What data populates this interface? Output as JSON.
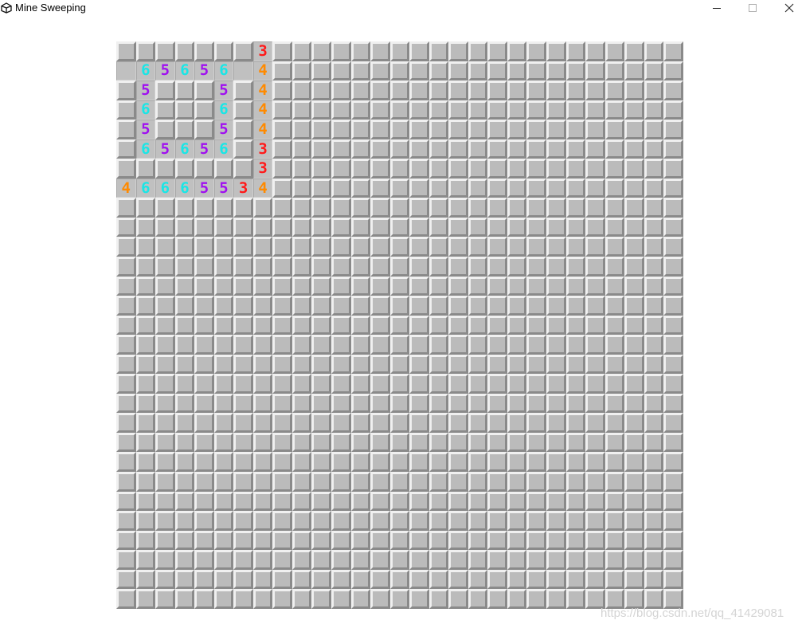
{
  "window": {
    "title": "Mine Sweeping",
    "icon": "unity-icon",
    "controls": [
      "minimize-icon",
      "maximize-icon",
      "close-icon"
    ]
  },
  "board": {
    "rows": 29,
    "cols": 29,
    "revealed": [
      {
        "r": 0,
        "c": 7,
        "v": "3"
      },
      {
        "r": 1,
        "c": 0,
        "v": ""
      },
      {
        "r": 1,
        "c": 1,
        "v": "6"
      },
      {
        "r": 1,
        "c": 2,
        "v": "5"
      },
      {
        "r": 1,
        "c": 3,
        "v": "6"
      },
      {
        "r": 1,
        "c": 4,
        "v": "5"
      },
      {
        "r": 1,
        "c": 5,
        "v": "6"
      },
      {
        "r": 1,
        "c": 6,
        "v": ""
      },
      {
        "r": 1,
        "c": 7,
        "v": "4"
      },
      {
        "r": 2,
        "c": 1,
        "v": "5"
      },
      {
        "r": 2,
        "c": 5,
        "v": "5"
      },
      {
        "r": 2,
        "c": 7,
        "v": "4"
      },
      {
        "r": 3,
        "c": 1,
        "v": "6"
      },
      {
        "r": 3,
        "c": 5,
        "v": "6"
      },
      {
        "r": 3,
        "c": 7,
        "v": "4"
      },
      {
        "r": 4,
        "c": 1,
        "v": "5"
      },
      {
        "r": 4,
        "c": 5,
        "v": "5"
      },
      {
        "r": 4,
        "c": 7,
        "v": "4"
      },
      {
        "r": 5,
        "c": 1,
        "v": "6"
      },
      {
        "r": 5,
        "c": 2,
        "v": "5"
      },
      {
        "r": 5,
        "c": 3,
        "v": "6"
      },
      {
        "r": 5,
        "c": 4,
        "v": "5"
      },
      {
        "r": 5,
        "c": 5,
        "v": "6"
      },
      {
        "r": 5,
        "c": 7,
        "v": "3"
      },
      {
        "r": 6,
        "c": 7,
        "v": "3"
      },
      {
        "r": 7,
        "c": 0,
        "v": "4"
      },
      {
        "r": 7,
        "c": 1,
        "v": "6"
      },
      {
        "r": 7,
        "c": 2,
        "v": "6"
      },
      {
        "r": 7,
        "c": 3,
        "v": "6"
      },
      {
        "r": 7,
        "c": 4,
        "v": "5"
      },
      {
        "r": 7,
        "c": 5,
        "v": "5"
      },
      {
        "r": 7,
        "c": 6,
        "v": "3"
      },
      {
        "r": 7,
        "c": 7,
        "v": "4"
      }
    ]
  },
  "number_colors": {
    "3": "#ff1a1a",
    "4": "#ff8a00",
    "5": "#a010f0",
    "6": "#19e6e6"
  },
  "watermark": "https://blog.csdn.net/qq_41429081"
}
